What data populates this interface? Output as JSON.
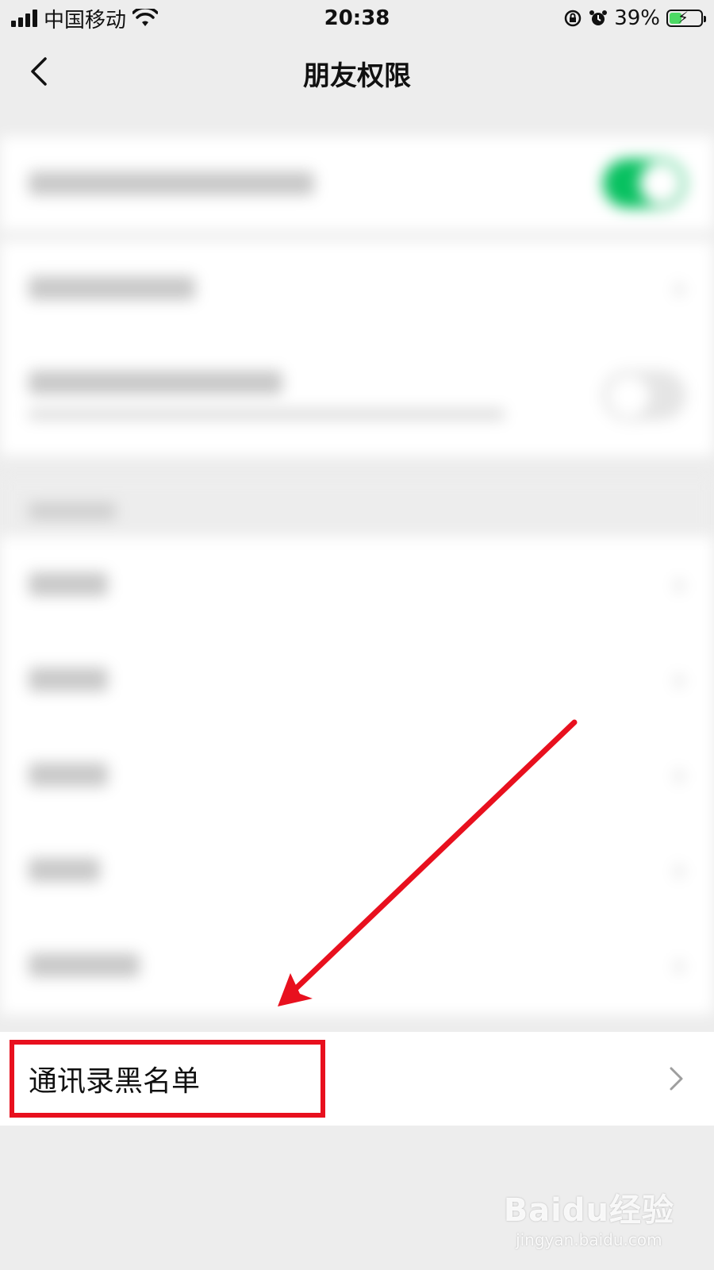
{
  "status_bar": {
    "carrier": "中国移动",
    "time": "20:38",
    "battery": "39%",
    "battery_level": 0.39,
    "icons": [
      "signal-icon",
      "wifi-icon",
      "orientation-lock-icon",
      "alarm-icon",
      "battery-icon"
    ]
  },
  "nav": {
    "title": "朋友权限",
    "back_icon": "chevron-left-icon"
  },
  "settings": {
    "rows_blurred": true,
    "toggle_states": [
      "on",
      "off"
    ],
    "accent_color": "#07c160"
  },
  "blacklist": {
    "label": "通讯录黑名单",
    "chevron_icon": "chevron-right-icon"
  },
  "annotation": {
    "color": "#e8101e"
  },
  "watermark": {
    "brand": "Baidu经验",
    "url": "jingyan.baidu.com"
  }
}
